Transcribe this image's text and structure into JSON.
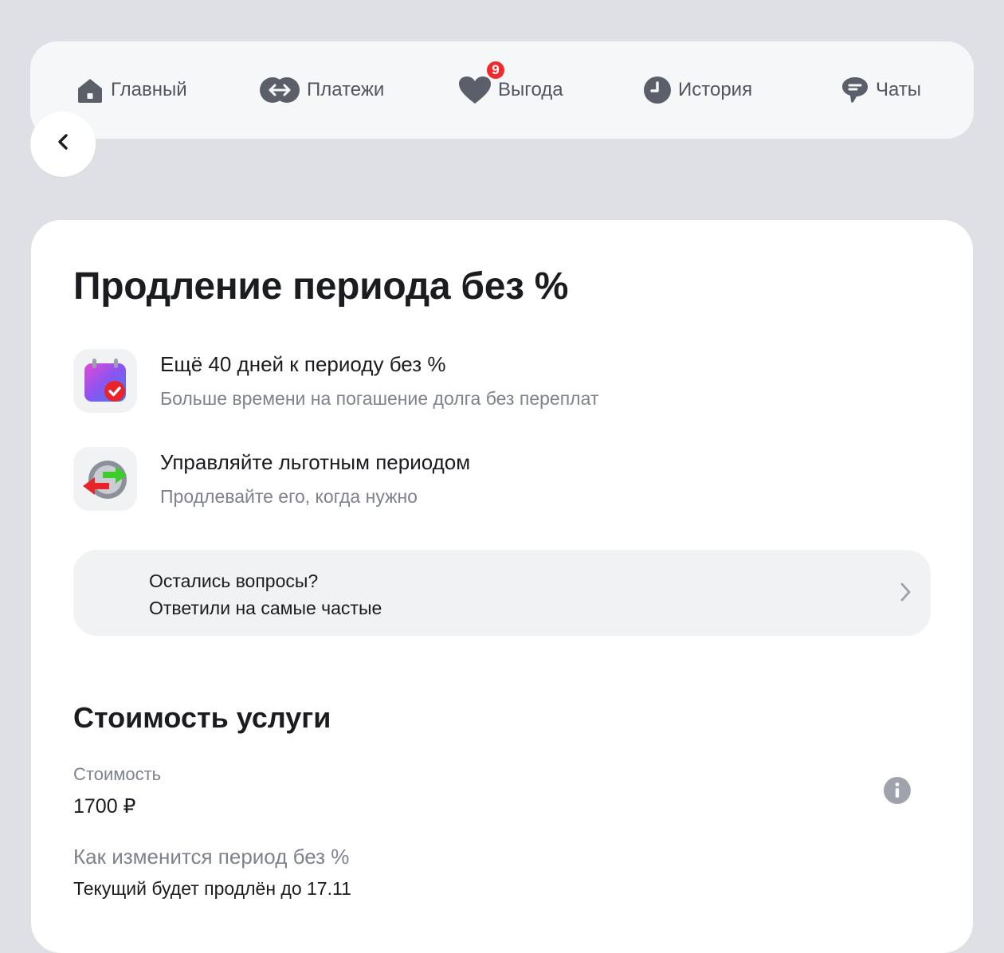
{
  "nav": {
    "items": [
      {
        "label": "Главный",
        "icon": "home-icon"
      },
      {
        "label": "Платежи",
        "icon": "transfer-icon"
      },
      {
        "label": "Выгода",
        "icon": "heart-icon",
        "badge": "9"
      },
      {
        "label": "История",
        "icon": "clock-icon"
      },
      {
        "label": "Чаты",
        "icon": "chat-icon"
      }
    ]
  },
  "page": {
    "title": "Продление периода без %",
    "features": [
      {
        "title": "Ещё 40 дней к периоду без %",
        "subtitle": "Больше времени на погашение долга без переплат",
        "icon": "calendar-check-icon"
      },
      {
        "title": "Управляйте льготным периодом",
        "subtitle": "Продлевайте его, когда нужно",
        "icon": "exchange-arrows-icon"
      }
    ],
    "faq": {
      "line1": "Остались вопросы?",
      "line2": "Ответили на самые частые"
    },
    "cost": {
      "heading": "Стоимость услуги",
      "price_label": "Стоимость",
      "price_value": "1700 ₽",
      "period_label": "Как изменится период без %",
      "period_value": "Текущий будет продлён до 17.11"
    }
  },
  "colors": {
    "background": "#dfe0e5",
    "badge": "#ef2b2d",
    "text": "#1b1c1f",
    "muted": "#7d828c"
  }
}
